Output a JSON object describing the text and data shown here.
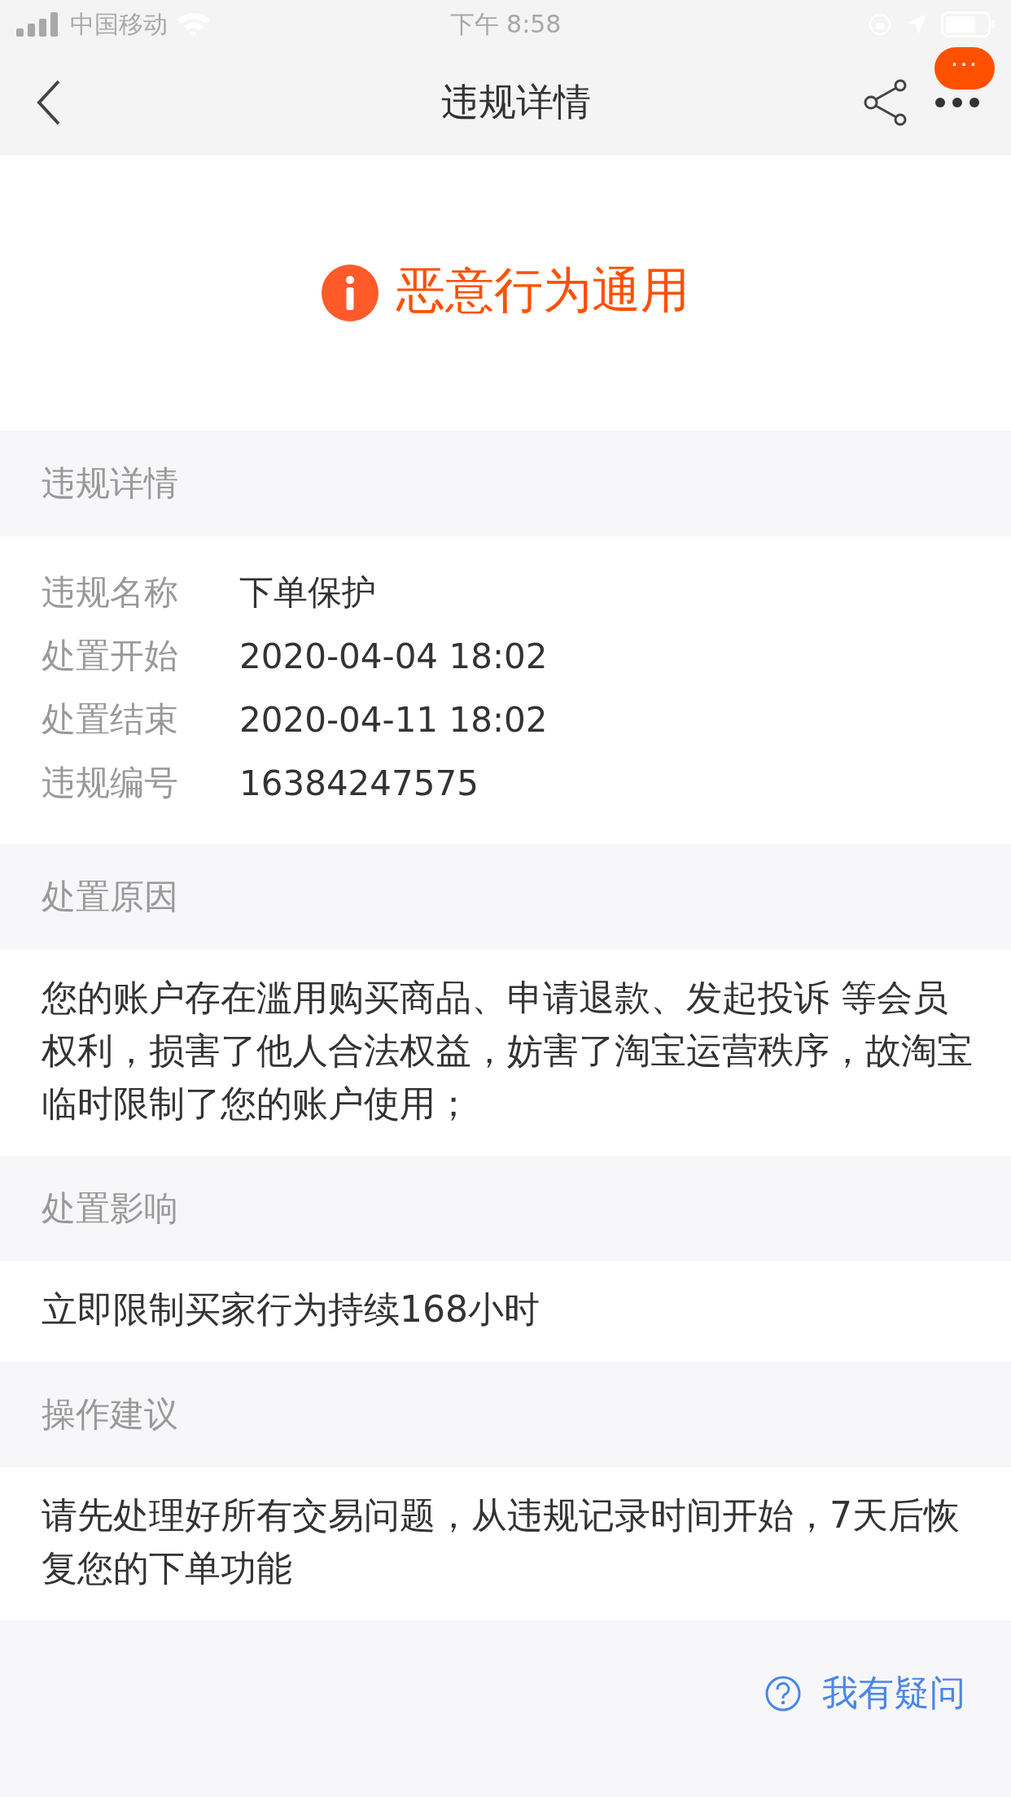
{
  "status_bar": {
    "carrier": "中国移动",
    "time": "下午 8:58"
  },
  "nav": {
    "title": "违规详情",
    "badge": "···"
  },
  "banner": {
    "title": "恶意行为通用"
  },
  "sections": [
    {
      "title": "违规详情",
      "kind": "fields",
      "fields": [
        {
          "label": "违规名称",
          "value": "下单保护"
        },
        {
          "label": "处置开始",
          "value": "2020-04-04 18:02"
        },
        {
          "label": "处置结束",
          "value": "2020-04-11 18:02"
        },
        {
          "label": "违规编号",
          "value": "16384247575"
        }
      ]
    },
    {
      "title": "处置原因",
      "kind": "text",
      "text": "您的账户存在滥用购买商品、申请退款、发起投诉 等会员权利，损害了他人合法权益，妨害了淘宝运营秩序，故淘宝临时限制了您的账户使用；"
    },
    {
      "title": "处置影响",
      "kind": "text",
      "text": "立即限制买家行为持续168小时"
    },
    {
      "title": "操作建议",
      "kind": "text",
      "text": "请先处理好所有交易问题，从违规记录时间开始，7天后恢复您的下单功能"
    }
  ],
  "help_link": "我有疑问"
}
